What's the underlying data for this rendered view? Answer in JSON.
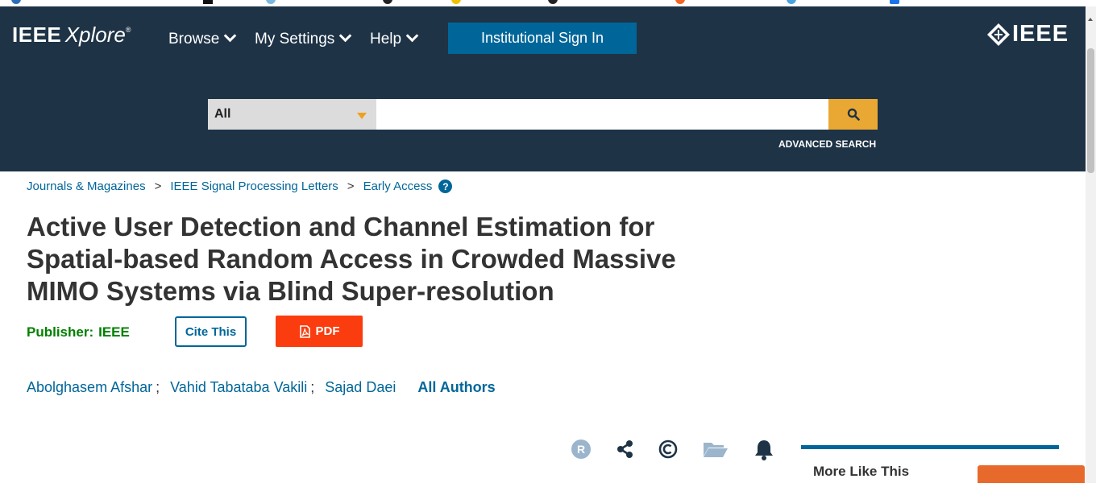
{
  "header": {
    "logo_brand": "IEEE",
    "logo_product": "Xplore",
    "logo_reg": "®",
    "nav": [
      {
        "label": "Browse"
      },
      {
        "label": "My Settings"
      },
      {
        "label": "Help"
      }
    ],
    "signin_label": "Institutional Sign In",
    "ieee_logo": "IEEE"
  },
  "search": {
    "scope": "All",
    "value": "",
    "advanced_label": "ADVANCED SEARCH"
  },
  "breadcrumb": {
    "items": [
      "Journals & Magazines",
      "IEEE Signal Processing Letters",
      "Early Access"
    ],
    "separator": ">",
    "help_glyph": "?"
  },
  "article": {
    "title": "Active User Detection and Channel Estimation for Spatial-based Random Access in Crowded Massive MIMO Systems via Blind Super-resolution",
    "publisher_label": "Publisher:",
    "publisher": "IEEE",
    "cite_label": "Cite This",
    "pdf_label": "PDF",
    "authors": [
      "Abolghasem Afshar",
      "Vahid Tabataba Vakili",
      "Sajad Daei"
    ],
    "author_separator": ";",
    "all_authors_label": "All Authors"
  },
  "toolbar_icons": [
    "rights-icon",
    "share-icon",
    "copyright-icon",
    "folder-icon",
    "bell-icon"
  ],
  "sidebar": {
    "more_like_title": "More Like This"
  },
  "colors": {
    "header_bg": "#1e3346",
    "accent_blue": "#006699",
    "pdf_red": "#fa3c0f",
    "search_gold": "#e9a833",
    "publisher_green": "#008000"
  }
}
